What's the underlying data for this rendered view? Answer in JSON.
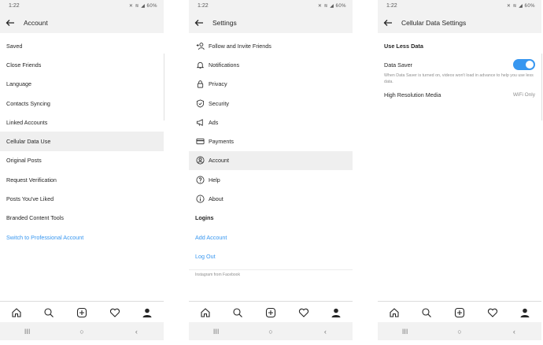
{
  "status": {
    "time": "1:22",
    "battery": "60%",
    "icons": "✕ ≋ ◢ 60%"
  },
  "account": {
    "title": "Account",
    "items": [
      "Saved",
      "Close Friends",
      "Language",
      "Contacts Syncing",
      "Linked Accounts",
      "Cellular Data Use",
      "Original Posts",
      "Request Verification",
      "Posts You've Liked",
      "Branded Content Tools"
    ],
    "switch_label": "Switch to Professional Account",
    "selected_index": 5
  },
  "settings": {
    "title": "Settings",
    "items": [
      {
        "label": "Follow and Invite Friends",
        "icon": "add-person-icon"
      },
      {
        "label": "Notifications",
        "icon": "bell-icon"
      },
      {
        "label": "Privacy",
        "icon": "lock-icon"
      },
      {
        "label": "Security",
        "icon": "shield-icon"
      },
      {
        "label": "Ads",
        "icon": "megaphone-icon"
      },
      {
        "label": "Payments",
        "icon": "card-icon"
      },
      {
        "label": "Account",
        "icon": "account-icon"
      },
      {
        "label": "Help",
        "icon": "help-icon"
      },
      {
        "label": "About",
        "icon": "info-icon"
      }
    ],
    "logins_label": "Logins",
    "add_account": "Add Account",
    "log_out": "Log Out",
    "footer": "Instagram from Facebook",
    "selected_index": 6
  },
  "cellular": {
    "title": "Cellular Data Settings",
    "section": "Use Less Data",
    "data_saver_label": "Data Saver",
    "data_saver_on": true,
    "description": "When Data Saver is turned on, videos won't load in advance to help you use less data.",
    "hires_label": "High Resolution Media",
    "hires_value": "WiFi Only"
  },
  "colors": {
    "link": "#3897f0",
    "selected_row": "#efefef",
    "toggle": "#3897f0"
  },
  "bottom_nav": [
    "home-icon",
    "search-icon",
    "add-post-icon",
    "heart-icon",
    "profile-icon"
  ],
  "system_nav": {
    "recents": "III",
    "home": "○",
    "back": "‹"
  }
}
